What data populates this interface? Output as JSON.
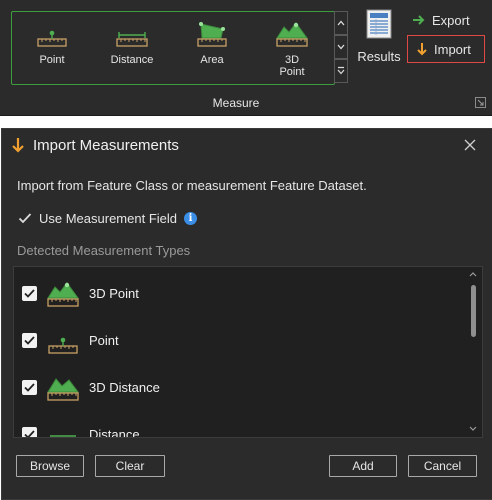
{
  "ribbon": {
    "gallery": {
      "items": [
        {
          "label": "Point",
          "icon": "point-measure-icon"
        },
        {
          "label": "Distance",
          "icon": "distance-measure-icon"
        },
        {
          "label": "Area",
          "icon": "area-measure-icon"
        },
        {
          "label": "3D Point",
          "icon": "3d-point-measure-icon"
        }
      ]
    },
    "results_label": "Results",
    "export_label": "Export",
    "import_label": "Import",
    "group_label": "Measure"
  },
  "dialog": {
    "title": "Import Measurements",
    "description": "Import from Feature Class or measurement Feature Dataset.",
    "use_field": {
      "label": "Use Measurement Field",
      "checked": true
    },
    "section_label": "Detected Measurement Types",
    "types": [
      {
        "label": "3D Point",
        "checked": true,
        "icon": "3d-point-measure-icon"
      },
      {
        "label": "Point",
        "checked": true,
        "icon": "point-measure-icon"
      },
      {
        "label": "3D Distance",
        "checked": true,
        "icon": "3d-distance-measure-icon"
      },
      {
        "label": "Distance",
        "checked": true,
        "icon": "distance-measure-icon"
      }
    ],
    "buttons": {
      "browse": "Browse",
      "clear": "Clear",
      "add": "Add",
      "cancel": "Cancel"
    }
  },
  "colors": {
    "accent_green": "#4fae4f",
    "import_highlight": "#e04848",
    "arrow_orange": "#f0a030",
    "info_blue": "#3a8ee6",
    "ruler_tan": "#c7a064"
  }
}
